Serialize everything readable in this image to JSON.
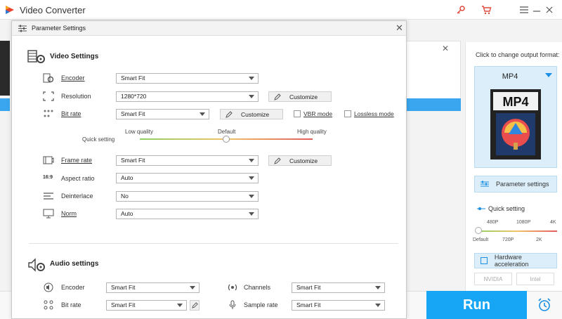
{
  "app": {
    "title": "Video Converter",
    "colors": {
      "accent": "#17a6f5",
      "selected_bg": "#dbeef9"
    }
  },
  "icons": {
    "app_logo": "play-logo-icon",
    "key": "key-icon",
    "cart": "cart-icon",
    "menu": "hamburger-menu-icon",
    "minimize": "minimize-icon",
    "close": "close-icon"
  },
  "sidebar": {
    "change_format_label": "Click to change output format:",
    "format": {
      "name": "MP4",
      "icon_text": "MP4"
    },
    "param_settings_label": "Parameter settings",
    "quick_setting_label": "Quick setting",
    "slider": {
      "top_labels": [
        "480P",
        "1080P",
        "4K"
      ],
      "bottom_labels": [
        "Default",
        "720P",
        "2K"
      ],
      "value": 0
    },
    "hardware_accel_label": "Hardware acceleration",
    "chips": [
      "NVIDIA",
      "Intel"
    ]
  },
  "run_label": "Run",
  "dialog": {
    "title": "Parameter Settings",
    "video": {
      "section_title": "Video Settings",
      "encoder": {
        "label": "Encoder",
        "value": "Smart Fit"
      },
      "resolution": {
        "label": "Resolution",
        "value": "1280*720",
        "customize": "Customize"
      },
      "bitrate": {
        "label": "Bit rate",
        "value": "Smart Fit",
        "customize": "Customize",
        "vbr_label": "VBR mode",
        "vbr_checked": false,
        "lossless_label": "Lossless mode",
        "lossless_checked": false
      },
      "quick_setting": {
        "label": "Quick setting",
        "low": "Low quality",
        "default": "Default",
        "high": "High quality",
        "value": 0.5
      },
      "framerate": {
        "label": "Frame rate",
        "value": "Smart Fit",
        "customize": "Customize"
      },
      "aspect": {
        "label": "Aspect ratio",
        "value": "Auto",
        "icon_text": "16:9"
      },
      "deinterlace": {
        "label": "Deinterlace",
        "value": "No"
      },
      "norm": {
        "label": "Norm",
        "value": "Auto"
      }
    },
    "audio": {
      "section_title": "Audio settings",
      "encoder": {
        "label": "Encoder",
        "value": "Smart Fit"
      },
      "channels": {
        "label": "Channels",
        "value": "Smart Fit"
      },
      "bitrate": {
        "label": "Bit rate",
        "value": "Smart Fit"
      },
      "sample_rate": {
        "label": "Sample rate",
        "value": "Smart Fit"
      }
    }
  }
}
